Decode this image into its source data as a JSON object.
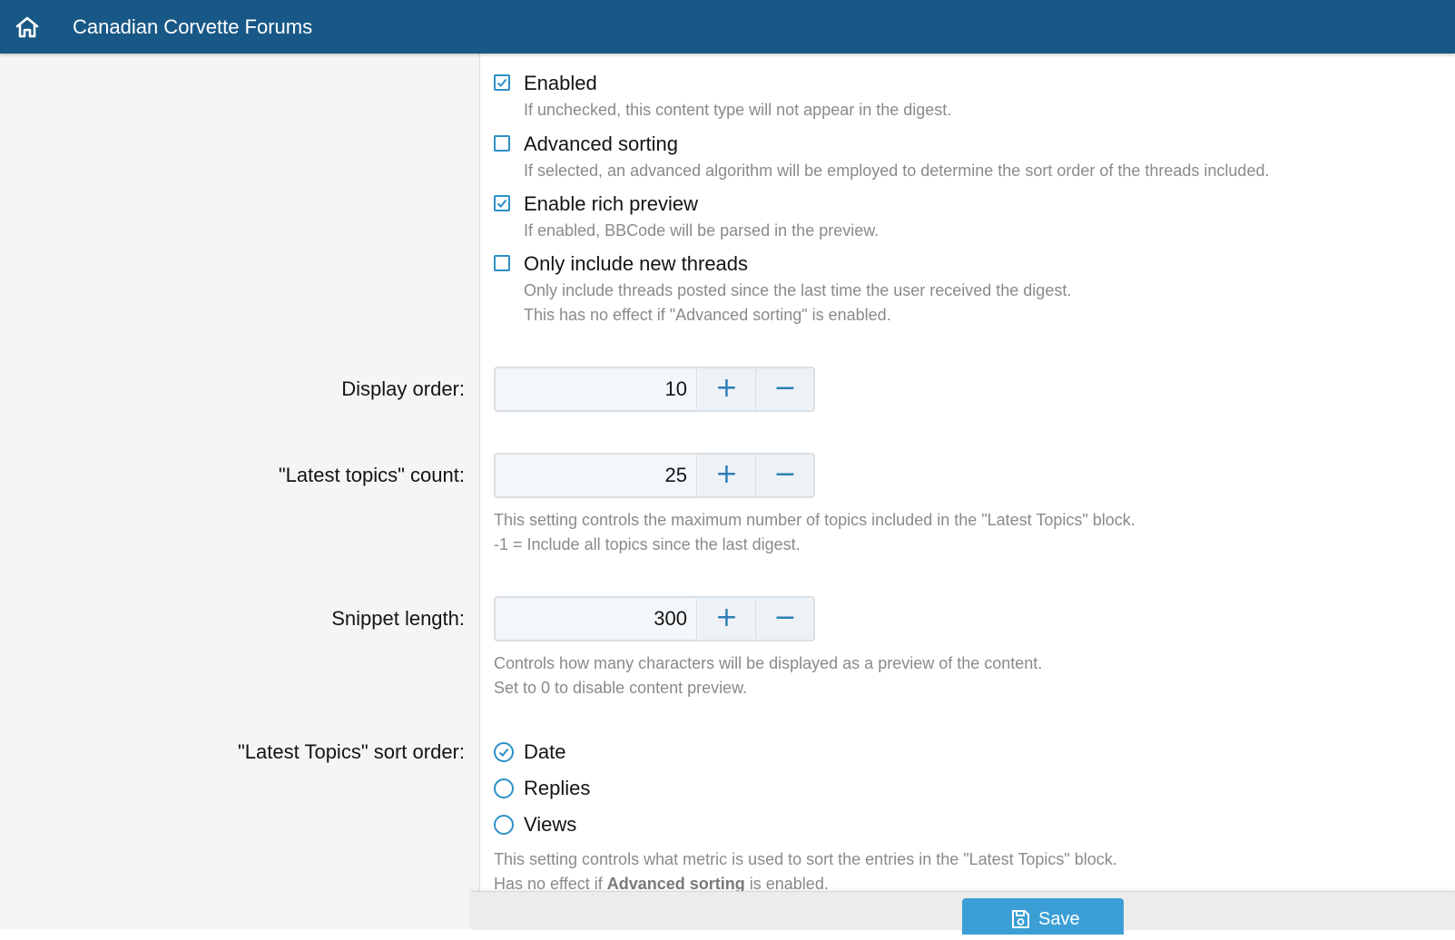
{
  "header": {
    "title": "Canadian Corvette Forums",
    "home_icon": "home-icon"
  },
  "options": [
    {
      "label": "Enabled",
      "checked": true,
      "hint": "If unchecked, this content type will not appear in the digest."
    },
    {
      "label": "Advanced sorting",
      "checked": false,
      "hint": "If selected, an advanced algorithm will be employed to determine the sort order of the threads included."
    },
    {
      "label": "Enable rich preview",
      "checked": true,
      "hint": "If enabled, BBCode will be parsed in the preview."
    },
    {
      "label": "Only include new threads",
      "checked": false,
      "hint": "Only include threads posted since the last time the user received the digest.",
      "hint2": "This has no effect if \"Advanced sorting\" is enabled."
    }
  ],
  "display_order": {
    "label": "Display order:",
    "value": "10",
    "plus": "+",
    "minus": "−"
  },
  "latest_topics_count": {
    "label": "\"Latest topics\" count:",
    "value": "25",
    "plus": "+",
    "minus": "−",
    "hint": "This setting controls the maximum number of topics included in the \"Latest Topics\" block.",
    "hint2": "-1 = Include all topics since the last digest."
  },
  "snippet_length": {
    "label": "Snippet length:",
    "value": "300",
    "plus": "+",
    "minus": "−",
    "hint": "Controls how many characters will be displayed as a preview of the content.",
    "hint2": "Set to 0 to disable content preview."
  },
  "sort_order": {
    "label": "\"Latest Topics\" sort order:",
    "options": [
      {
        "label": "Date",
        "selected": true
      },
      {
        "label": "Replies",
        "selected": false
      },
      {
        "label": "Views",
        "selected": false
      }
    ],
    "hint": "This setting controls what metric is used to sort the entries in the \"Latest Topics\" block.",
    "hint2_pre": "Has no effect if ",
    "hint2_bold": "Advanced sorting",
    "hint2_post": " is enabled."
  },
  "footer": {
    "save_label": "Save",
    "save_icon": "save-icon"
  },
  "colors": {
    "header_bg": "#185886",
    "accent": "#2d8fc7",
    "save_button": "#3b9fd5"
  }
}
